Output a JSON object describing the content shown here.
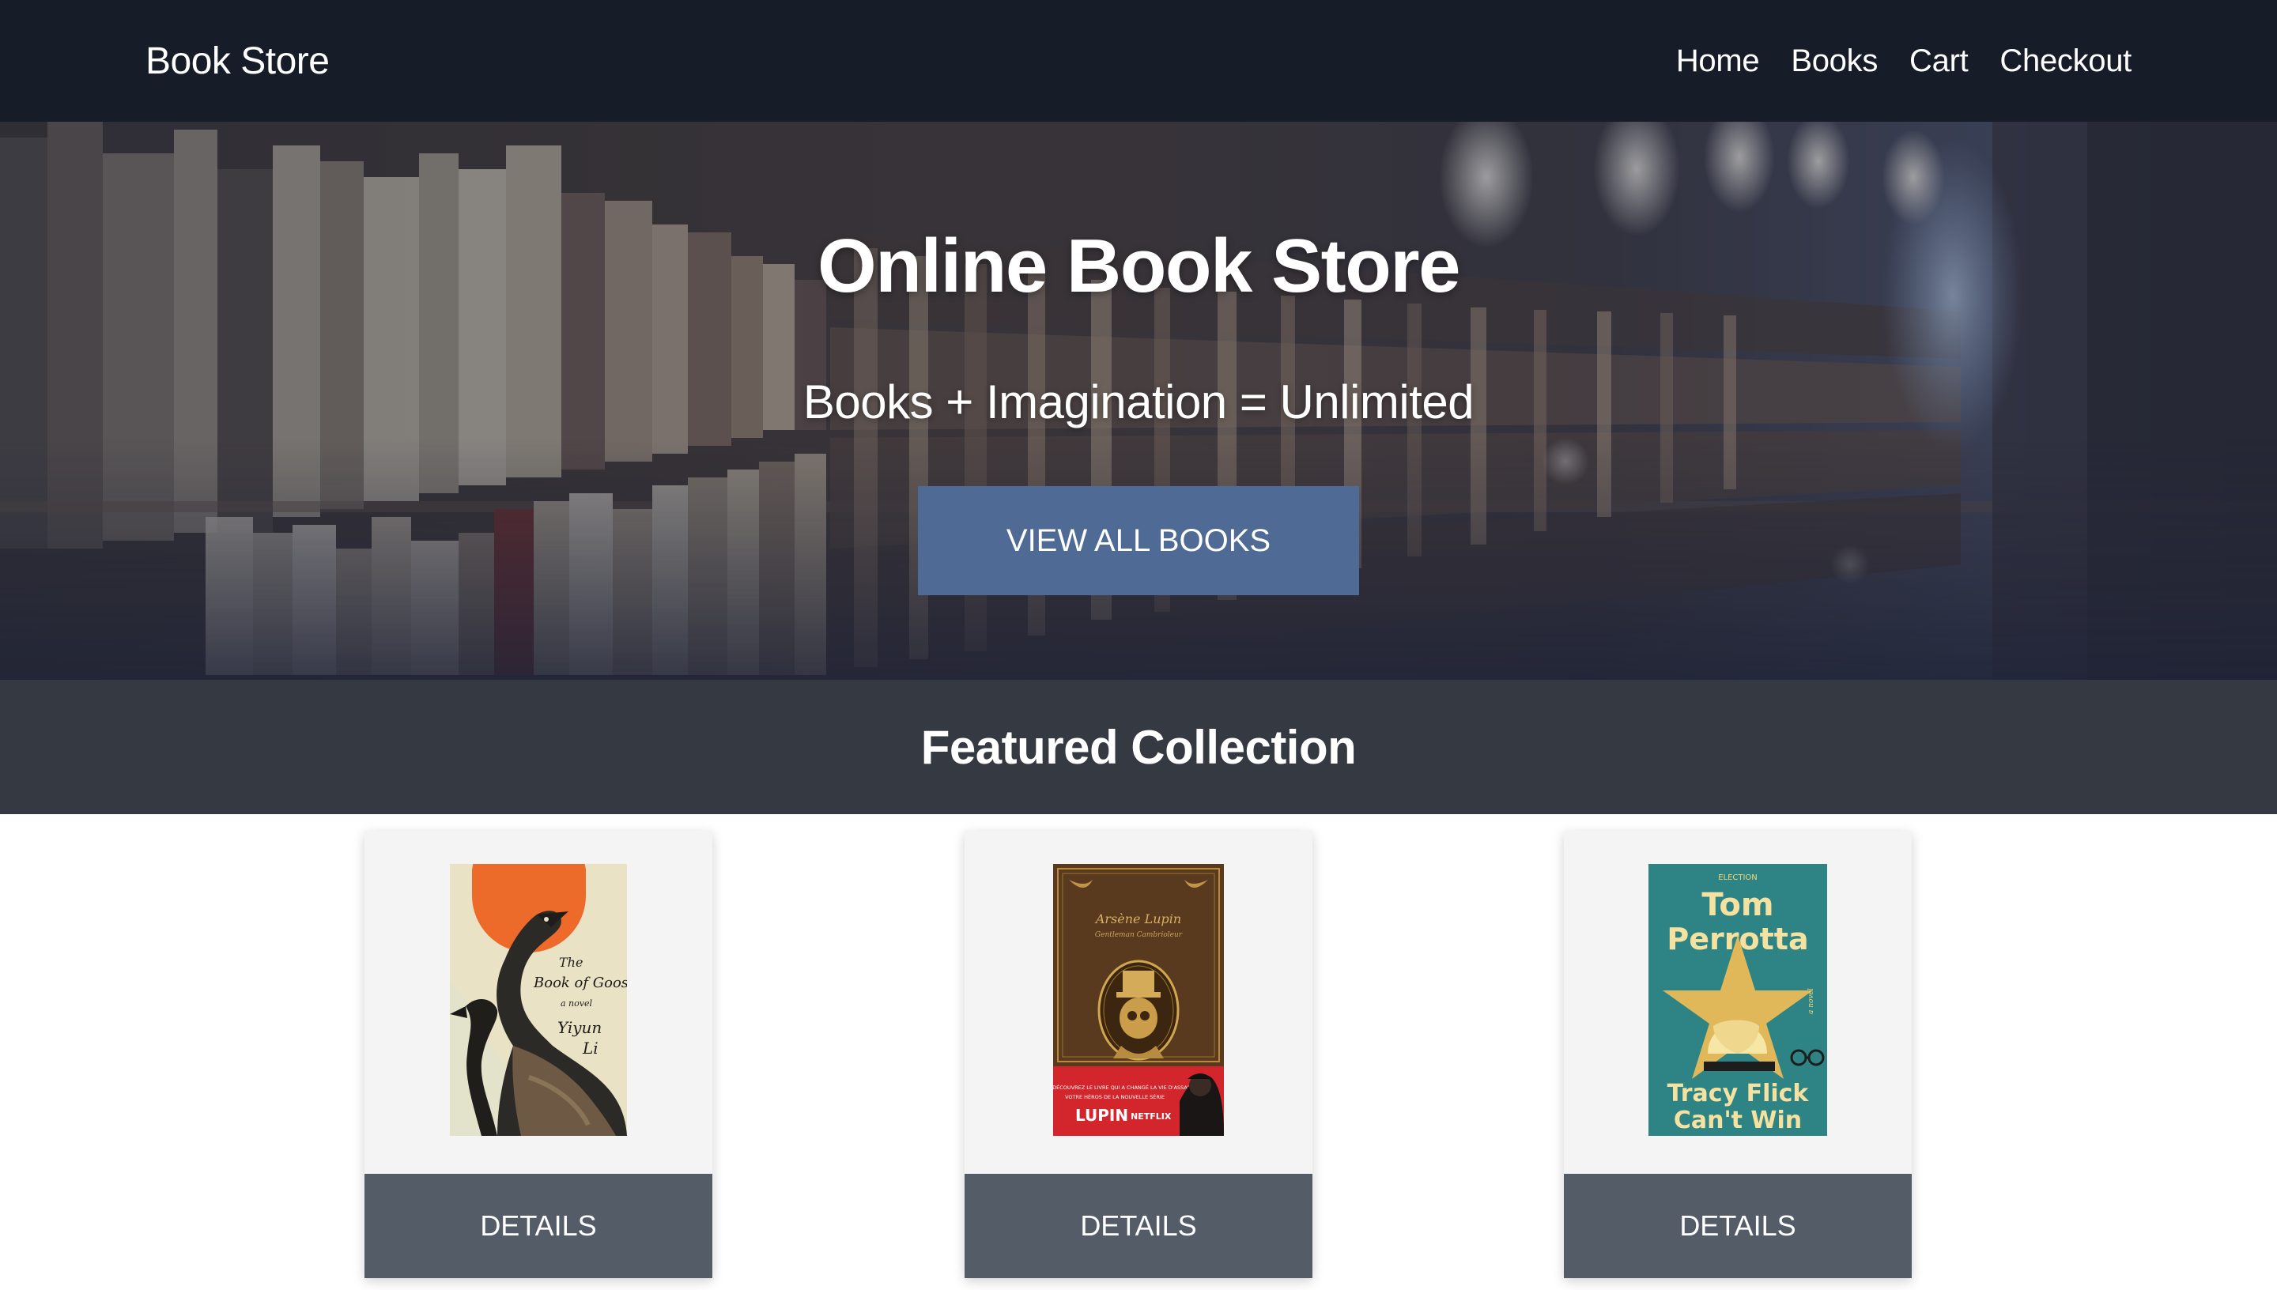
{
  "navbar": {
    "brand": "Book Store",
    "links": [
      "Home",
      "Books",
      "Cart",
      "Checkout"
    ]
  },
  "hero": {
    "title": "Online Book Store",
    "subtitle": "Books + Imagination = Unlimited",
    "button_label": "VIEW ALL BOOKS"
  },
  "featured": {
    "title": "Featured Collection",
    "books": [
      {
        "cover_texts": [
          "The Book of Goose",
          "a novel",
          "Yiyun Li"
        ],
        "details_label": "DETAILS"
      },
      {
        "cover_texts": [
          "Arsène Lupin",
          "Gentleman Cambrioleur",
          "DÉCOUVREZ LE LIVRE QUI A CHANGÉ LA VIE D'ASSANE,",
          "VOTRE HÉROS DE LA NOUVELLE SÉRIE",
          "LUPIN",
          "NETFLIX"
        ],
        "details_label": "DETAILS"
      },
      {
        "cover_texts": [
          "ELECTION",
          "Tom",
          "Perrotta",
          "Tracy Flick",
          "Can't Win",
          "a novel"
        ],
        "details_label": "DETAILS"
      }
    ]
  },
  "colors": {
    "navbar_bg": "#161c28",
    "hero_button": "#4f6a95",
    "featured_band": "#353a42",
    "card_bg": "#f4f4f4",
    "card_button": "#545c68"
  }
}
